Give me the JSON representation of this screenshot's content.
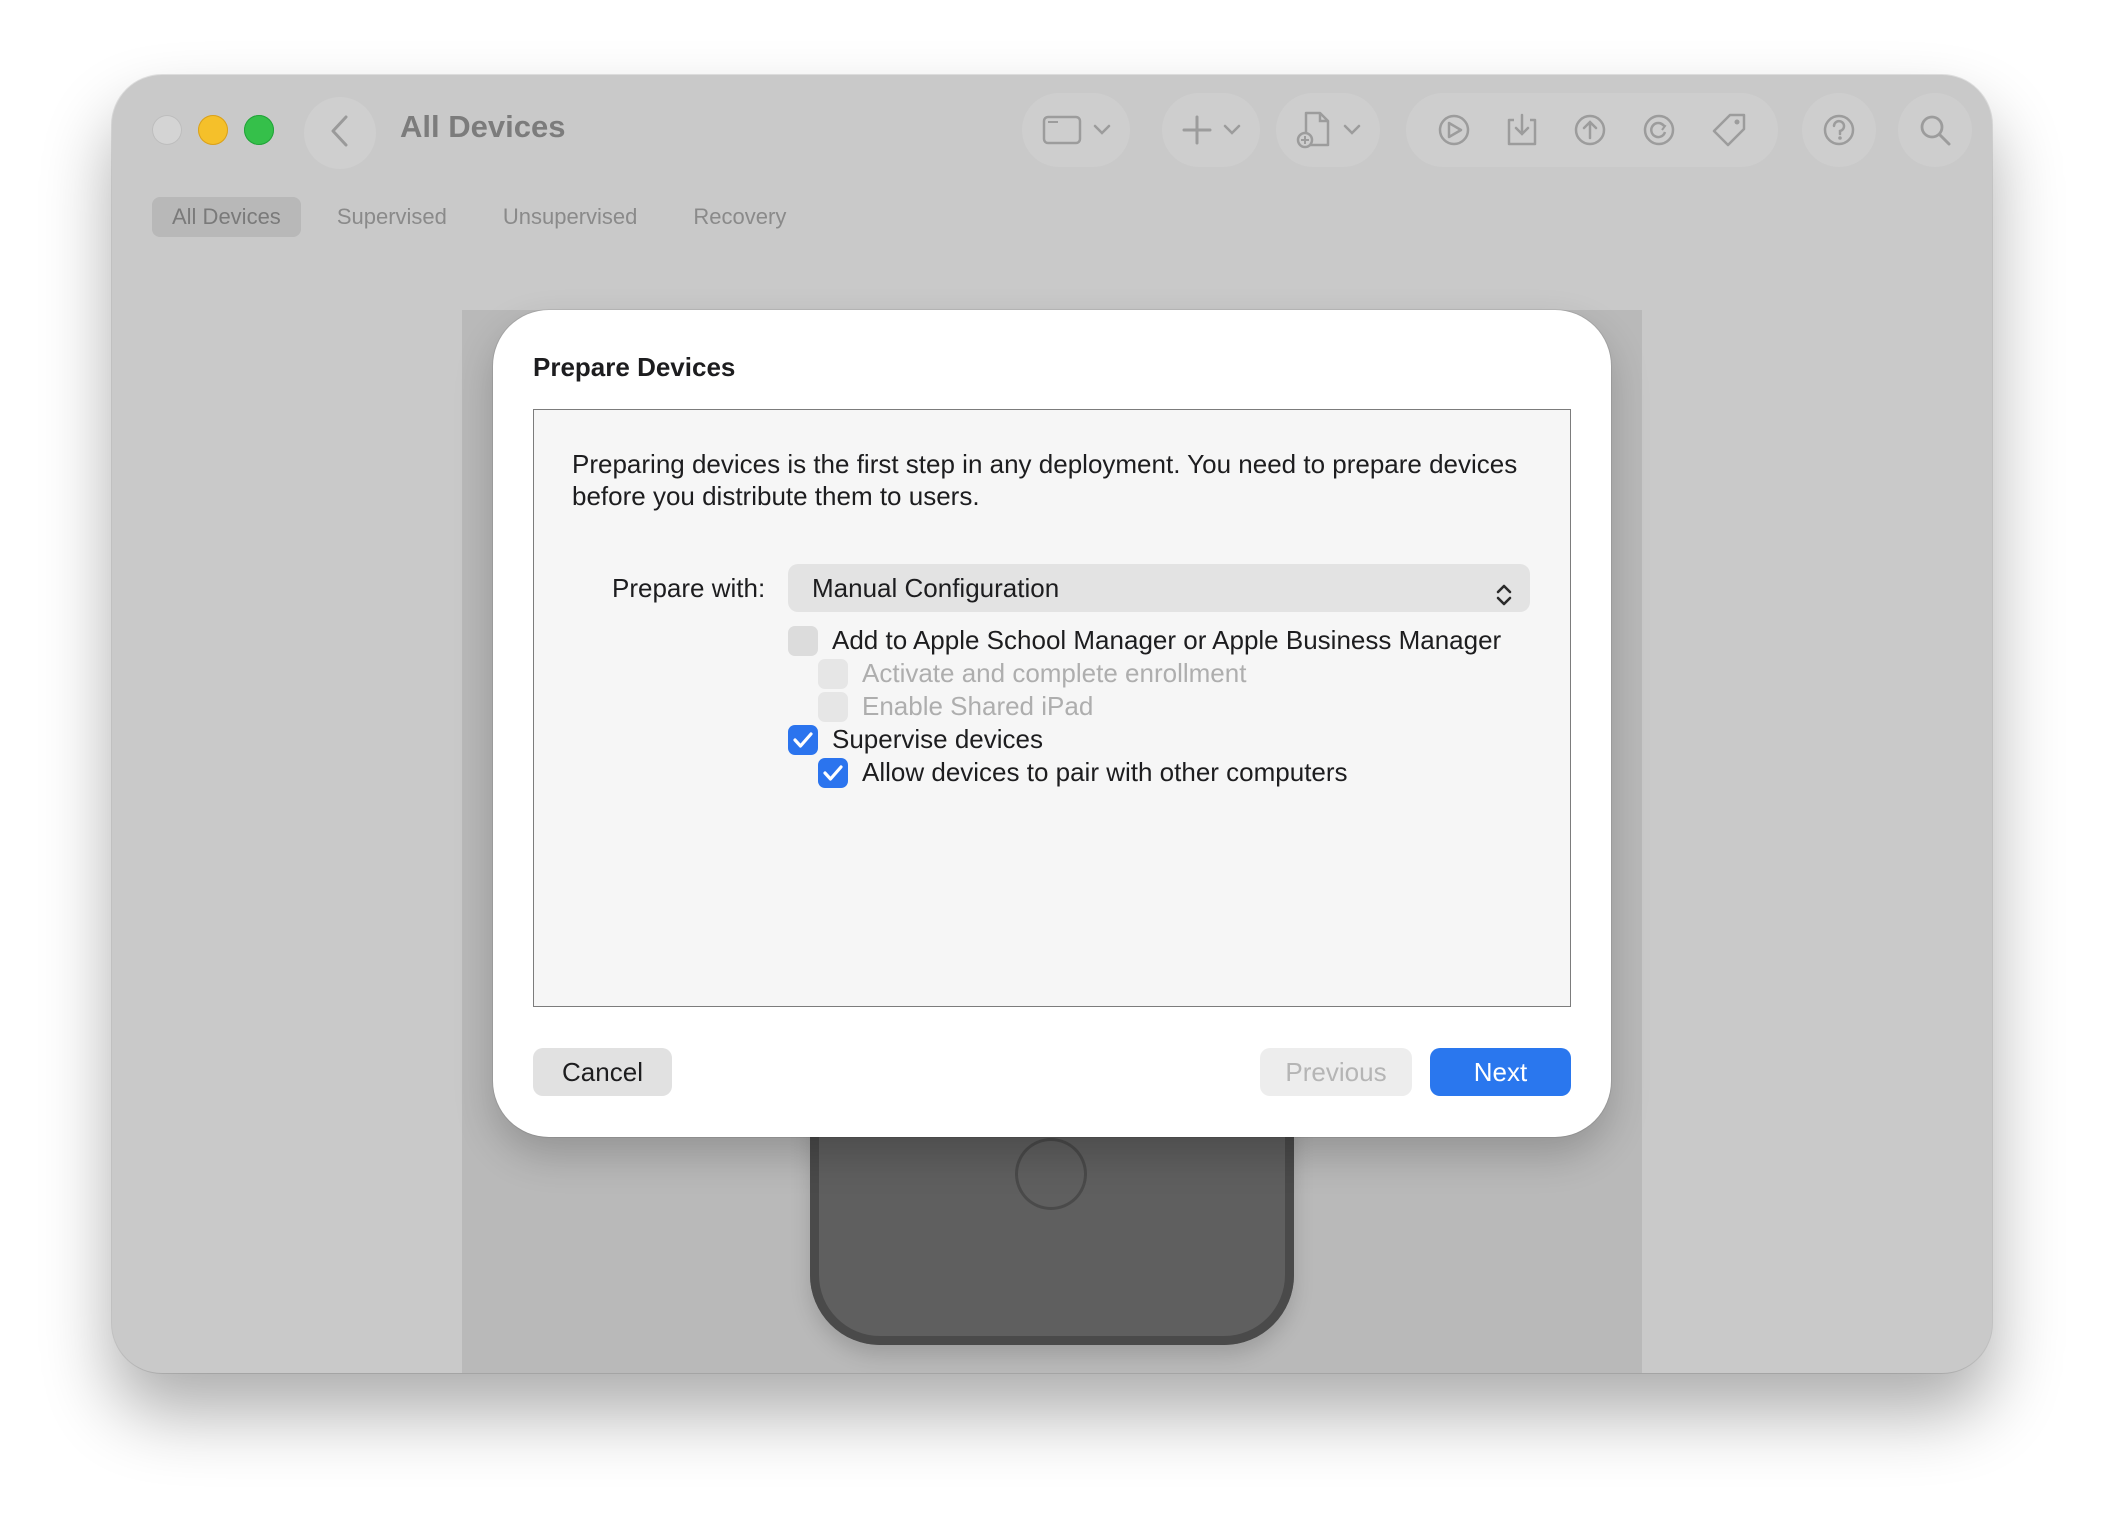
{
  "window": {
    "title": "All Devices",
    "traffic_lights": [
      "close",
      "minimize",
      "zoom"
    ],
    "back_icon": "chevron-left-icon"
  },
  "toolbar": {
    "groups": [
      {
        "icons": [
          "sidebar-view-icon",
          "chevron-down-icon"
        ]
      },
      {
        "icons": [
          "plus-icon",
          "chevron-down-icon"
        ]
      },
      {
        "icons": [
          "new-document-icon",
          "chevron-down-icon"
        ]
      },
      {
        "icons": [
          "apps-icon",
          "download-icon",
          "upload-icon",
          "restore-icon",
          "tag-icon"
        ]
      },
      {
        "icons": [
          "help-icon"
        ]
      },
      {
        "icons": [
          "search-icon"
        ]
      }
    ]
  },
  "tabs": [
    {
      "label": "All Devices",
      "active": true
    },
    {
      "label": "Supervised",
      "active": false
    },
    {
      "label": "Unsupervised",
      "active": false
    },
    {
      "label": "Recovery",
      "active": false
    }
  ],
  "dialog": {
    "title": "Prepare Devices",
    "description": "Preparing devices is the first step in any deployment. You need to prepare devices before you distribute them to users.",
    "prepare_with_label": "Prepare with:",
    "prepare_with_value": "Manual Configuration",
    "options": [
      {
        "label": "Add to Apple School Manager or Apple Business Manager",
        "checked": false,
        "enabled": true
      },
      {
        "label": "Activate and complete enrollment",
        "checked": false,
        "enabled": false
      },
      {
        "label": "Enable Shared iPad",
        "checked": false,
        "enabled": false
      },
      {
        "label": "Supervise devices",
        "checked": true,
        "enabled": true
      },
      {
        "label": "Allow devices to pair with other computers",
        "checked": true,
        "enabled": true
      }
    ],
    "buttons": {
      "cancel": "Cancel",
      "previous": "Previous",
      "next": "Next"
    }
  },
  "colors": {
    "accent": "#2a77ee",
    "window_dimmed": "#c9c9c9",
    "traffic_min": "#f5c02a",
    "traffic_max": "#35c04a"
  }
}
